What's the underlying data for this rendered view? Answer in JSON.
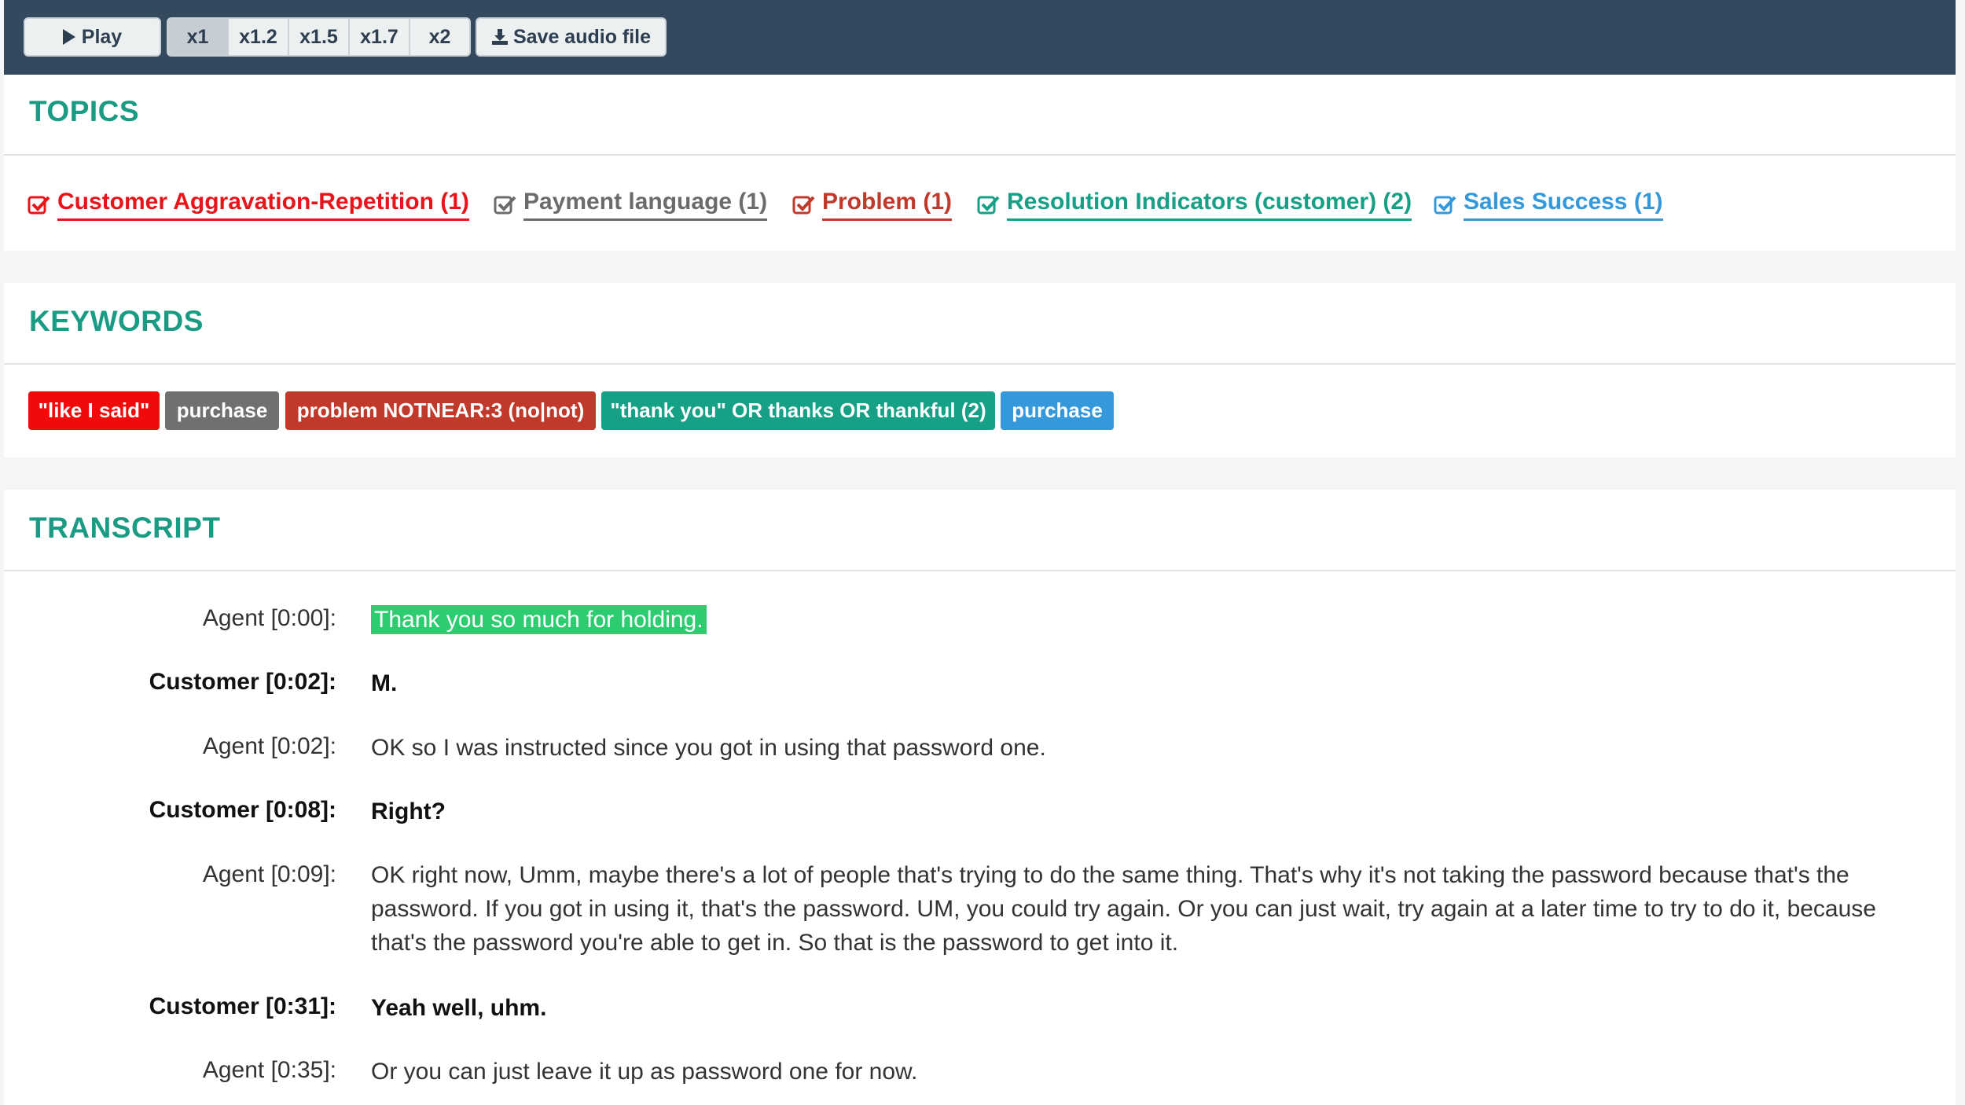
{
  "toolbar": {
    "play_label": "Play",
    "speeds": [
      "x1",
      "x1.2",
      "x1.5",
      "x1.7",
      "x2"
    ],
    "active_speed": "x1",
    "save_label": "Save audio file"
  },
  "topics": {
    "title": "TOPICS",
    "items": [
      {
        "label": "Customer Aggravation-Repetition (1)",
        "color": "#e8141a"
      },
      {
        "label": "Payment language (1)",
        "color": "#6b6b6b"
      },
      {
        "label": "Problem (1)",
        "color": "#c0392b"
      },
      {
        "label": "Resolution Indicators (customer) (2)",
        "color": "#16a085"
      },
      {
        "label": "Sales Success (1)",
        "color": "#3498db"
      }
    ]
  },
  "keywords": {
    "title": "KEYWORDS",
    "items": [
      {
        "label": "\"like I said\"",
        "color": "#f00a0a"
      },
      {
        "label": "purchase",
        "color": "#707070"
      },
      {
        "label": "problem NOTNEAR:3 (no|not)",
        "color": "#c0392b"
      },
      {
        "label": "\"thank you\" OR thanks OR thankful (2)",
        "color": "#16a085"
      },
      {
        "label": "purchase",
        "color": "#3498db"
      }
    ]
  },
  "transcript": {
    "title": "TRANSCRIPT",
    "lines": [
      {
        "speaker": "Agent [0:00]:",
        "text": "Thank you so much for holding.",
        "role": "agent",
        "highlight": true
      },
      {
        "speaker": "Customer [0:02]:",
        "text": "M.",
        "role": "customer"
      },
      {
        "speaker": "Agent [0:02]:",
        "text": "OK so I was instructed since you got in using that password one.",
        "role": "agent"
      },
      {
        "speaker": "Customer [0:08]:",
        "text": "Right?",
        "role": "customer"
      },
      {
        "speaker": "Agent [0:09]:",
        "text": "OK right now, Umm, maybe there's a lot of people that's trying to do the same thing. That's why it's not taking the password because that's the password. If you got in using it, that's the password. UM, you could try again. Or you can just wait, try again at a later time to try to do it, because that's the password you're able to get in. So that is the password to get into it.",
        "role": "agent"
      },
      {
        "speaker": "Customer [0:31]:",
        "text": "Yeah well, uhm.",
        "role": "customer"
      },
      {
        "speaker": "Agent [0:35]:",
        "text": "Or you can just leave it up as password one for now.",
        "role": "agent"
      }
    ]
  }
}
